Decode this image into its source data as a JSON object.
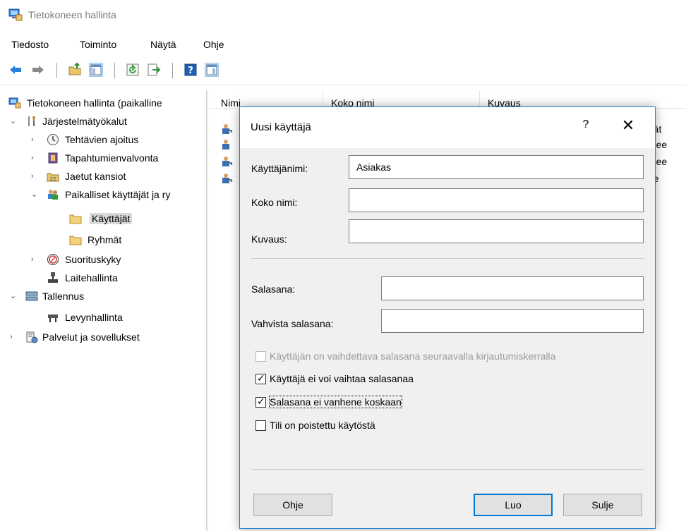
{
  "window": {
    "title": "Tietokoneen hallinta"
  },
  "menu": [
    "Tiedosto",
    "Toiminto",
    "Näytä",
    "Ohje"
  ],
  "toolbar": {
    "icons": [
      "back-arrow-icon",
      "forward-arrow-icon",
      "up-folder-icon",
      "show-hide-tree-icon",
      "refresh-icon",
      "export-list-icon",
      "help-icon",
      "action-pane-icon"
    ]
  },
  "tree": [
    {
      "label": "Tietokoneen hallinta (paikalline",
      "icon": "computer-management-icon"
    },
    {
      "label": "Järjestelmätyökalut",
      "icon": "system-tools-icon",
      "expanded": true
    },
    {
      "label": "Tehtävien ajoitus",
      "icon": "clock-icon"
    },
    {
      "label": "Tapahtumienvalvonta",
      "icon": "event-viewer-icon"
    },
    {
      "label": "Jaetut kansiot",
      "icon": "shared-folder-icon"
    },
    {
      "label": "Paikalliset käyttäjät ja ry",
      "icon": "users-groups-icon",
      "expanded": true
    },
    {
      "label": "Käyttäjät",
      "icon": "folder-icon",
      "selected": true
    },
    {
      "label": "Ryhmät",
      "icon": "folder-icon"
    },
    {
      "label": "Suorituskyky",
      "icon": "performance-icon"
    },
    {
      "label": "Laitehallinta",
      "icon": "device-manager-icon"
    },
    {
      "label": "Tallennus",
      "icon": "storage-icon",
      "expanded": true
    },
    {
      "label": "Levynhallinta",
      "icon": "disk-management-icon"
    },
    {
      "label": "Palvelut ja sovellukset",
      "icon": "services-icon"
    }
  ],
  "list": {
    "columns": [
      "Nimi",
      "Koko nimi",
      "Kuvaus"
    ],
    "row_desc_fragments": [
      "ttäjät",
      "konee",
      "konee",
      "järje"
    ]
  },
  "dialog": {
    "title": "Uusi käyttäjä",
    "help_label": "?",
    "close_label": "✕",
    "fields": {
      "username_label": "Käyttäjänimi:",
      "username_value": "Asiakas",
      "fullname_label": "Koko nimi:",
      "fullname_value": "",
      "description_label": "Kuvaus:",
      "description_value": "",
      "password_label": "Salasana:",
      "password_value": "",
      "confirm_label": "Vahvista salasana:",
      "confirm_value": ""
    },
    "checkboxes": [
      {
        "label": "Käyttäjän on vaihdettava salasana seuraavalla kirjautumiskerralla",
        "checked": false,
        "disabled": true
      },
      {
        "label": "Käyttäjä ei voi vaihtaa salasanaa",
        "checked": true,
        "disabled": false
      },
      {
        "label": "Salasana ei vanhene koskaan",
        "checked": true,
        "disabled": false,
        "focused": true
      },
      {
        "label": "Tili on poistettu käytöstä",
        "checked": false,
        "disabled": false
      }
    ],
    "buttons": {
      "help": "Ohje",
      "create": "Luo",
      "close": "Sulje"
    }
  }
}
